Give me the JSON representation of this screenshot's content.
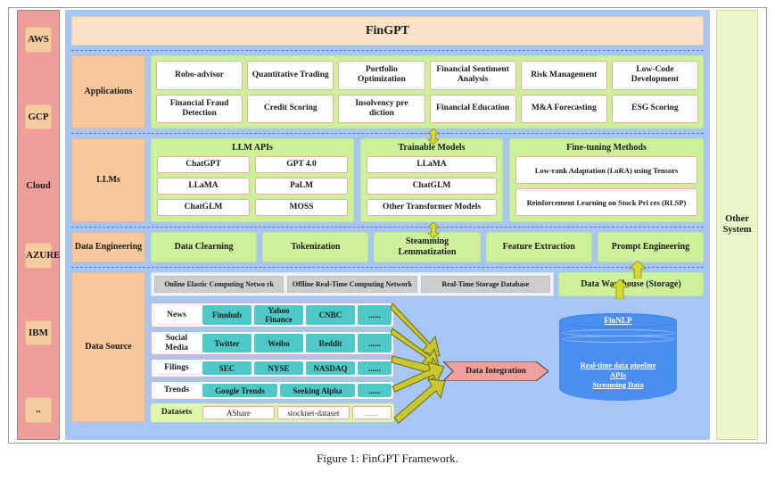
{
  "figure": {
    "caption": "Figure 1: FinGPT Framework."
  },
  "title": {
    "text": "FinGPT"
  },
  "cloud": {
    "label": "Cloud",
    "items": [
      "AWS",
      "GCP",
      "AZURE",
      "IBM",
      ".."
    ]
  },
  "other_system": {
    "label": "Other System"
  },
  "layers": {
    "applications": {
      "label": "Applications",
      "row1": [
        "Robo-advisor",
        "Quantitative Trading",
        "Portfolio Optimization",
        "Financial Sentiment Analysis",
        "Risk Management",
        "Low-Code Development"
      ],
      "row2": [
        "Financial Fraud Detection",
        "Credit Scoring",
        "Insolvency pre diction",
        "Financial Education",
        "M&A Forecasting",
        "ESG Scoring"
      ]
    },
    "llms": {
      "label": "LLMs",
      "groups": [
        {
          "title": "LLM APIs",
          "col1": [
            "ChatGPT",
            "LLaMA",
            "ChatGLM"
          ],
          "col2": [
            "GPT 4.0",
            "PaLM",
            "MOSS"
          ]
        },
        {
          "title": "Trainable Models",
          "col1": [
            "LLaMA",
            "ChatGLM",
            "Other Transformer Models"
          ]
        },
        {
          "title": "Fine-tuning Methods",
          "col1": [
            "Low-rank Adaptation (LoRA) using Tensors",
            "Reinforcement Learning on Stock Pri ces (RLSP)"
          ]
        }
      ]
    },
    "data_engineering": {
      "label": "Data Engineering",
      "items": [
        "Data Clearning",
        "Tokenization",
        "Steamming Lemmatization",
        "Feature Extraction",
        "Prompt Engineering"
      ]
    },
    "data_source": {
      "label": "Data Source",
      "infrastructure": [
        "Online Elastic Computing Netwo rk",
        "Offline Real-Time Computing Network",
        "Real-Time Storage Database"
      ],
      "data_warehouse": "Data Warehouse (Storage)",
      "sources": [
        {
          "name": "News",
          "items": [
            "Finnhub",
            "Yahoo Finance",
            "CNBC",
            "......"
          ]
        },
        {
          "name": "Social Media",
          "items": [
            "Twitter",
            "Weibo",
            "Reddit",
            "......"
          ]
        },
        {
          "name": "Filings",
          "items": [
            "SEC",
            "NYSE",
            "NASDAQ",
            "......"
          ]
        },
        {
          "name": "Trends",
          "items": [
            "Google Trends",
            "Seeking Alpha",
            "......"
          ]
        },
        {
          "name": "Datasets",
          "items": [
            "AShare",
            "stocknet-dataset",
            "......"
          ]
        }
      ],
      "integration": {
        "label": "Data Integration"
      },
      "store": {
        "title": "FinNLP",
        "lines": [
          "Real-time data pipeline",
          "APIs",
          "Streaming Data"
        ]
      }
    }
  },
  "colors": {
    "canvas": "#a8c6f5",
    "cloud": "#ee9d99",
    "cloud_chip": "#f7cba0",
    "layer_label": "#f6c89a",
    "green_panel": "#cdf09a",
    "title_bar": "#f9e2c6",
    "teal_chip": "#4fc8c8",
    "integration": "#f0a09a",
    "cylinder": "#4a8ef0",
    "arrow": "#c8c82e",
    "other_system": "#eaf7c9"
  }
}
